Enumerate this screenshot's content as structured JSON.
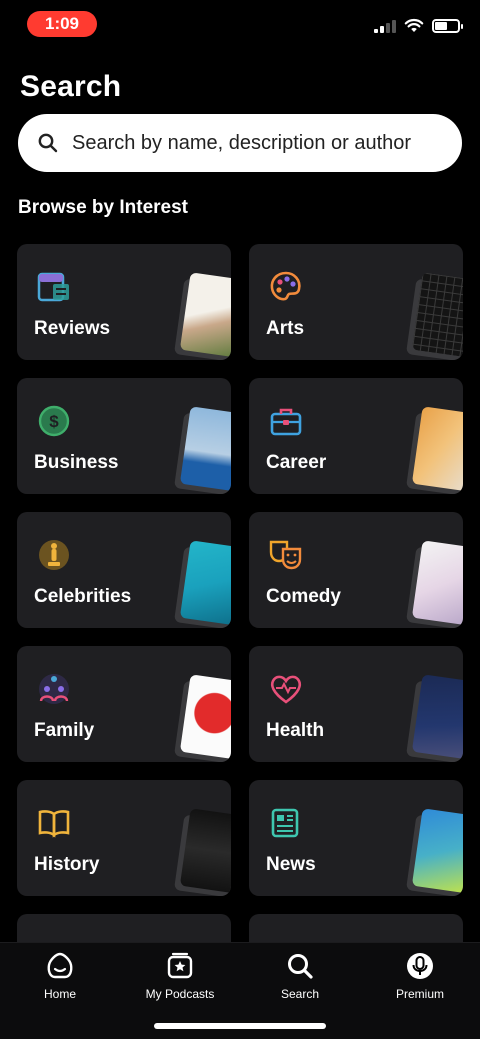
{
  "status_bar": {
    "time": "1:09"
  },
  "page": {
    "title": "Search"
  },
  "search": {
    "placeholder": "Search by name, description or author"
  },
  "browse": {
    "heading": "Browse by Interest",
    "categories": [
      {
        "label": "Reviews",
        "icon": "document-icon",
        "accent": "#4aa8d8"
      },
      {
        "label": "Arts",
        "icon": "palette-icon",
        "accent": "#f28b3c"
      },
      {
        "label": "Business",
        "icon": "dollar-coin-icon",
        "accent": "#3fae6b"
      },
      {
        "label": "Career",
        "icon": "briefcase-icon",
        "accent": "#3fa2e0"
      },
      {
        "label": "Celebrities",
        "icon": "oscar-statue-icon",
        "accent": "#d8a32c"
      },
      {
        "label": "Comedy",
        "icon": "comedy-masks-icon",
        "accent": "#f0a52b"
      },
      {
        "label": "Family",
        "icon": "family-icon",
        "accent": "#8a6ee8"
      },
      {
        "label": "Health",
        "icon": "heart-pulse-icon",
        "accent": "#e8507a"
      },
      {
        "label": "History",
        "icon": "open-book-icon",
        "accent": "#f0b43c"
      },
      {
        "label": "News",
        "icon": "newspaper-icon",
        "accent": "#3ec7b0"
      },
      {
        "label": "",
        "icon": "category-icon",
        "accent": "#3fa2e0"
      },
      {
        "label": "",
        "icon": "category-icon",
        "accent": "#8a3ee0"
      }
    ]
  },
  "tab_bar": {
    "tabs": [
      {
        "label": "Home",
        "icon": "home-icon"
      },
      {
        "label": "My Podcasts",
        "icon": "podcast-library-icon"
      },
      {
        "label": "Search",
        "icon": "search-icon",
        "active": true
      },
      {
        "label": "Premium",
        "icon": "premium-mic-icon"
      }
    ]
  }
}
